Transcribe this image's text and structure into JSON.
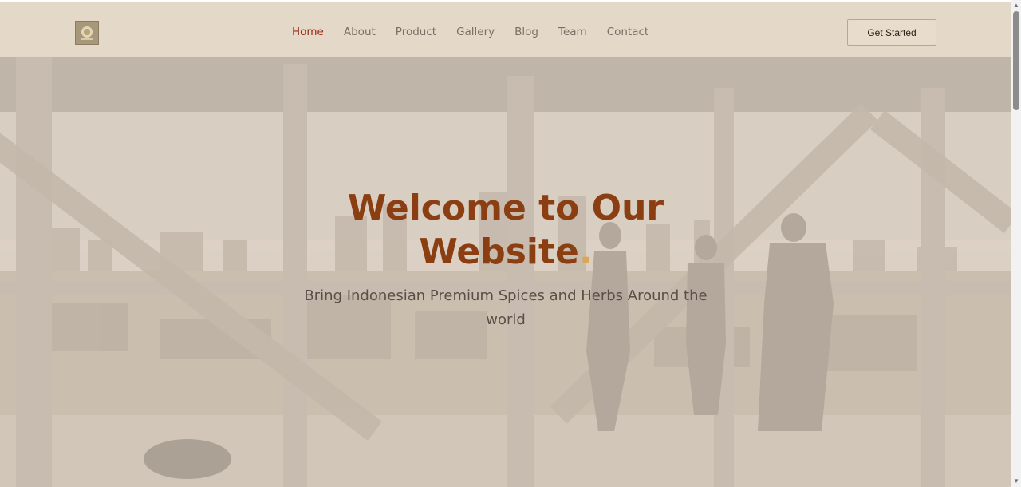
{
  "header": {
    "nav": [
      "Home",
      "About",
      "Product",
      "Gallery",
      "Blog",
      "Team",
      "Contact"
    ],
    "active_nav": "Home",
    "cta_label": "Get Started"
  },
  "hero": {
    "title_line1": "Welcome to Our",
    "title_line2": "Website",
    "title_dot": ".",
    "subtitle": "Bring Indonesian Premium Spices and Herbs Around the world",
    "background": "office-skyline-photo-icon"
  },
  "colors": {
    "accent": "#9b2b14",
    "title": "#8a3e12",
    "dot": "#d8a75c",
    "cta_border": "#d3a64d",
    "header_bg": "#e4d8c8"
  }
}
